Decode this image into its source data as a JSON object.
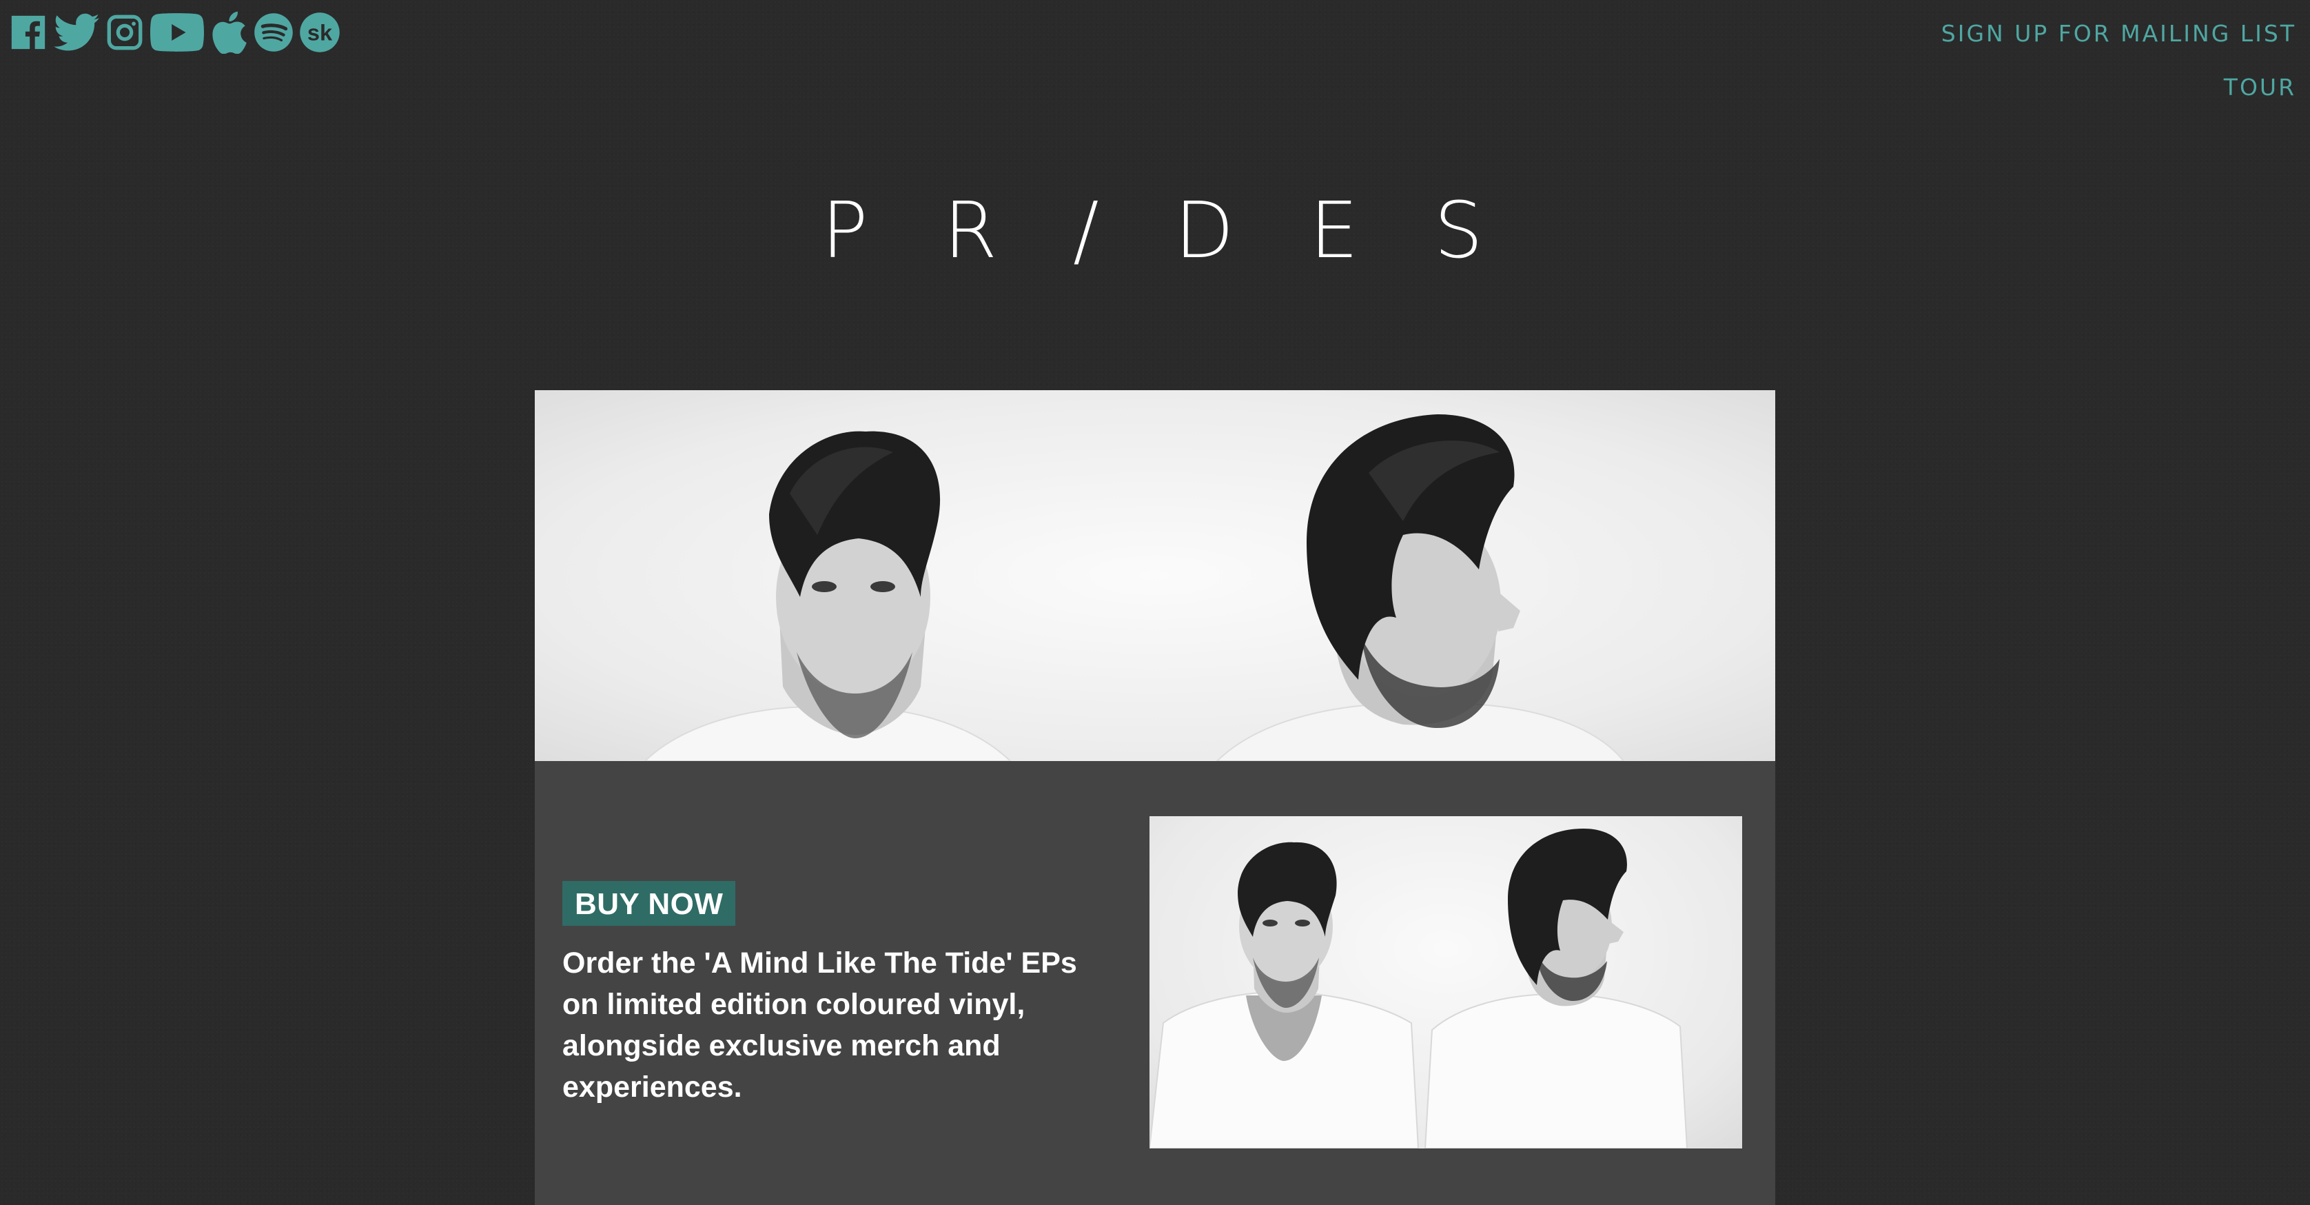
{
  "social": {
    "icons": [
      "facebook-icon",
      "twitter-icon",
      "instagram-icon",
      "youtube-icon",
      "apple-icon",
      "spotify-icon",
      "songkick-icon"
    ],
    "songkick_glyph": "sk"
  },
  "nav": {
    "mailing_list": "SIGN UP FOR MAILING LIST",
    "tour": "TOUR"
  },
  "logo": {
    "letters": [
      "P",
      "R",
      "/",
      "D",
      "E",
      "S"
    ]
  },
  "promo": {
    "buy_label": "BUY NOW",
    "description": "Order the 'A Mind Like The Tide' EPs on limited edition coloured vinyl, alongside exclusive merch and experiences."
  },
  "colors": {
    "accent": "#4fa7a2",
    "button_bg": "#2f6c66",
    "page_bg": "#2a2a2a",
    "card_bg": "#444444",
    "logo": "#ffffff"
  }
}
